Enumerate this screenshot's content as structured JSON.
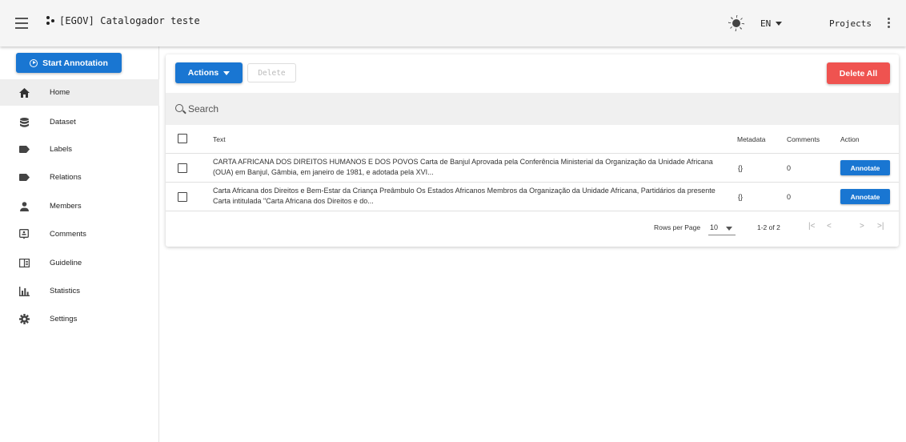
{
  "appbar": {
    "title": "[EGOV] Catalogador teste",
    "language": "EN",
    "projects_label": "Projects"
  },
  "sidebar": {
    "start_annotation": "Start Annotation",
    "items": [
      {
        "label": "Home",
        "icon": "home-icon",
        "active": true
      },
      {
        "label": "Dataset",
        "icon": "database-icon"
      },
      {
        "label": "Labels",
        "icon": "label-icon"
      },
      {
        "label": "Relations",
        "icon": "label-icon"
      },
      {
        "label": "Members",
        "icon": "account-icon"
      },
      {
        "label": "Comments",
        "icon": "comment-icon"
      },
      {
        "label": "Guideline",
        "icon": "book-icon"
      },
      {
        "label": "Statistics",
        "icon": "chart-icon"
      },
      {
        "label": "Settings",
        "icon": "gear-icon"
      }
    ]
  },
  "toolbar": {
    "actions_label": "Actions",
    "delete_label": "Delete",
    "delete_all_label": "Delete All"
  },
  "search": {
    "placeholder": "Search"
  },
  "table": {
    "headers": {
      "text": "Text",
      "metadata": "Metadata",
      "comments": "Comments",
      "action": "Action"
    },
    "rows": [
      {
        "text": "CARTA AFRICANA DOS DIREITOS HUMANOS E DOS POVOS Carta de Banjul Aprovada pela Conferência Ministerial da Organização da Unidade Africana (OUA) em Banjul, Gâmbia, em janeiro de 1981, e adotada pela XVI...",
        "metadata": "{}",
        "comments": "0",
        "action": "Annotate"
      },
      {
        "text": "Carta Africana dos Direitos e Bem-Estar da Criança Preâmbulo Os Estados Africanos Membros da Organização da Unidade Africana, Partidários da presente Carta intitulada \"Carta Africana dos Direitos e do...",
        "metadata": "{}",
        "comments": "0",
        "action": "Annotate"
      }
    ]
  },
  "pagination": {
    "rows_per_page_label": "Rows per Page",
    "rows_per_page_value": "10",
    "range": "1-2 of 2",
    "first": "|<",
    "prev": "<",
    "next": ">",
    "last": ">|"
  },
  "colors": {
    "primary": "#1976d2",
    "danger": "#ef5350",
    "appbar": "#f5f5f5"
  }
}
